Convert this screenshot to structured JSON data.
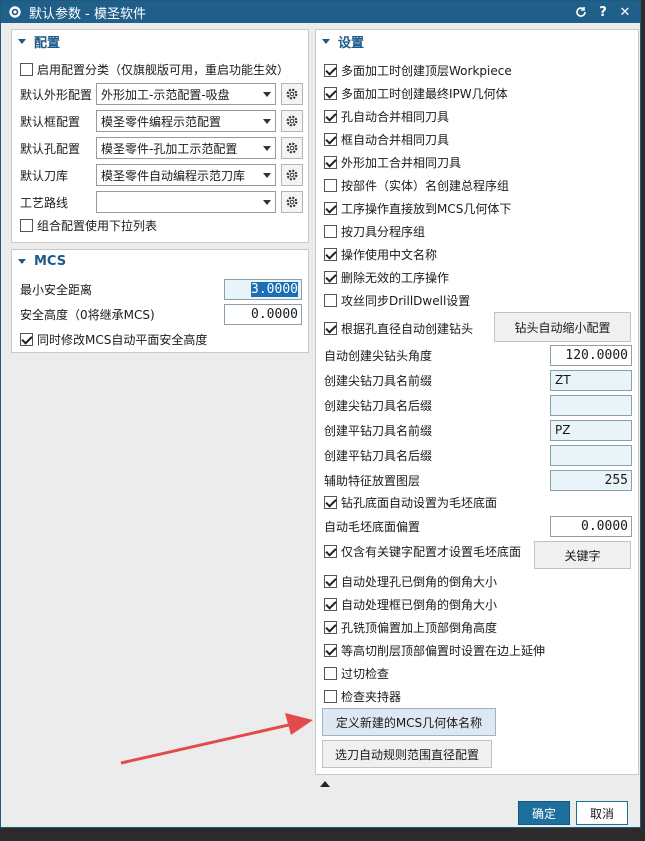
{
  "window": {
    "title": "默认参数 - 模圣软件",
    "refresh_icon": "refresh-icon",
    "help_label": "?",
    "close_label": "✕"
  },
  "config": {
    "header": "配置",
    "enable_category": "启用配置分类（仅旗舰版可用，重启功能生效）",
    "rows": [
      {
        "label": "默认外形配置",
        "value": "外形加工-示范配置-吸盘"
      },
      {
        "label": "默认框配置",
        "value": "模圣零件编程示范配置"
      },
      {
        "label": "默认孔配置",
        "value": "模圣零件-孔加工示范配置"
      },
      {
        "label": "默认刀库",
        "value": "模圣零件自动编程示范刀库"
      },
      {
        "label": "工艺路线",
        "value": ""
      }
    ],
    "combo_dropdown": "组合配置使用下拉列表"
  },
  "mcs": {
    "header": "MCS",
    "min_safe_label": "最小安全距离",
    "min_safe_value": "3.0000",
    "safe_height_label": "安全高度（0将继承MCS)",
    "safe_height_value": "0.0000",
    "sync_label": "同时修改MCS自动平面安全高度"
  },
  "settings": {
    "header": "设置",
    "checks_a": [
      {
        "label": "多面加工时创建顶层Workpiece",
        "checked": true
      },
      {
        "label": "多面加工时创建最终IPW几何体",
        "checked": true
      },
      {
        "label": "孔自动合并相同刀具",
        "checked": true
      },
      {
        "label": "框自动合并相同刀具",
        "checked": true
      },
      {
        "label": "外形加工合并相同刀具",
        "checked": true
      },
      {
        "label": "按部件（实体）名创建总程序组",
        "checked": false
      },
      {
        "label": "工序操作直接放到MCS几何体下",
        "checked": true
      },
      {
        "label": "按刀具分程序组",
        "checked": false
      },
      {
        "label": "操作使用中文名称",
        "checked": true
      },
      {
        "label": "删除无效的工序操作",
        "checked": true
      },
      {
        "label": "攻丝同步DrillDwell设置",
        "checked": false
      }
    ],
    "drill_auto_label": "根据孔直径自动创建钻头",
    "drill_auto_button": "钻头自动缩小配置",
    "fields": [
      {
        "label": "自动创建尖钻头角度",
        "value": "120.0000"
      },
      {
        "label": "创建尖钻刀具名前缀",
        "value": "ZT"
      },
      {
        "label": "创建尖钻刀具名后缀",
        "value": ""
      },
      {
        "label": "创建平钻刀具名前缀",
        "value": "PZ"
      },
      {
        "label": "创建平钻刀具名后缀",
        "value": ""
      },
      {
        "label": "辅助特征放置图层",
        "value": "255"
      }
    ],
    "hole_bottom_label": "钻孔底面自动设置为毛坯底面",
    "blank_offset_label": "自动毛坯底面偏置",
    "blank_offset_value": "0.0000",
    "keyword_label": "仅含有关键字配置才设置毛坯底面",
    "keyword_button": "关键字",
    "checks_b": [
      {
        "label": "自动处理孔已倒角的倒角大小",
        "checked": true
      },
      {
        "label": "自动处理框已倒角的倒角大小",
        "checked": true
      },
      {
        "label": "孔铣顶偏置加上顶部倒角高度",
        "checked": true
      },
      {
        "label": "等高切削层顶部偏置时设置在边上延伸",
        "checked": true
      },
      {
        "label": "过切检查",
        "checked": false
      },
      {
        "label": "检查夹持器",
        "checked": false
      }
    ],
    "define_mcs_button": "定义新建的MCS几何体名称",
    "range_button": "选刀自动规则范围直径配置"
  },
  "footer": {
    "ok": "确定",
    "cancel": "取消"
  },
  "colors": {
    "title_bar": "#1f5f8a",
    "accent": "#1c5a8a",
    "arrow": "#e34b4b",
    "ok_button": "#1f6f9c"
  }
}
